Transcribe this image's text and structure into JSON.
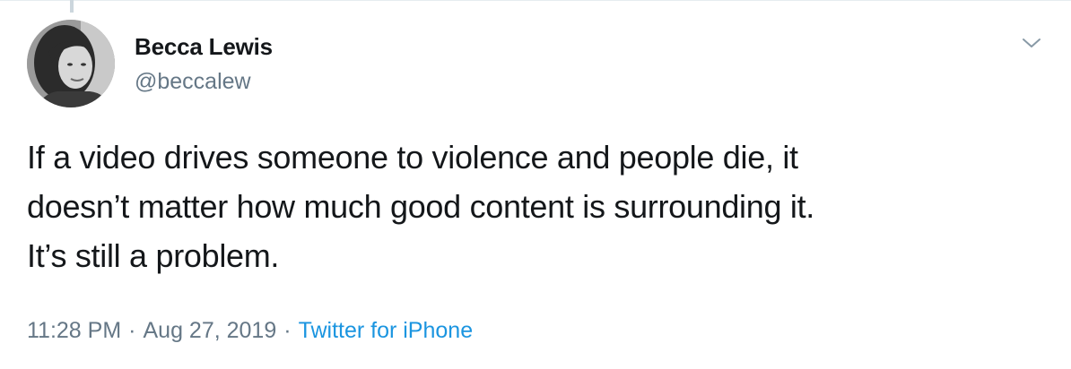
{
  "tweet": {
    "author": {
      "display_name": "Becca Lewis",
      "handle": "@beccalew",
      "avatar_icon": "user-avatar-photo"
    },
    "text": "If a video drives someone to violence and people die, it\ndoesn’t matter how much good content is surrounding it.\nIt’s still a problem.",
    "time": "11:28 PM",
    "separator": "·",
    "date": "Aug 27, 2019",
    "source": "Twitter for iPhone",
    "menu_icon": "chevron-down-icon"
  },
  "colors": {
    "text_primary": "#14171a",
    "text_secondary": "#657786",
    "link": "#1b95e0",
    "divider": "#e6ecf0"
  }
}
